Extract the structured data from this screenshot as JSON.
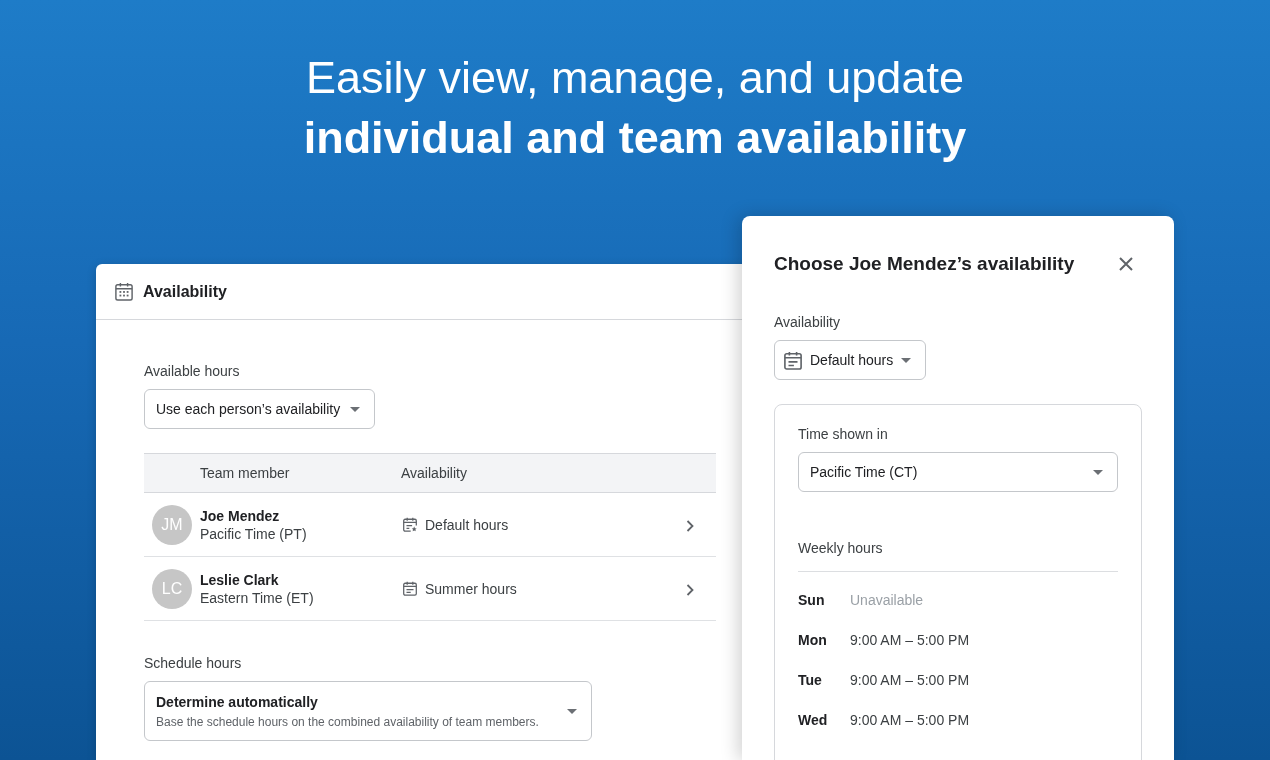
{
  "headline": "Easily view, manage, and update **individual and team availability**",
  "availability_panel": {
    "title": "Availability",
    "available_hours": {
      "label": "Available hours",
      "value": "Use each person’s availability"
    },
    "table": {
      "columns": [
        "Team member",
        "Availability"
      ],
      "rows": [
        {
          "initials": "JM",
          "name": "Joe Mendez",
          "time_zone": "Pacific Time (PT)",
          "availability": "Default hours",
          "kind": "default"
        },
        {
          "initials": "LC",
          "name": "Leslie Clark",
          "time_zone": "Eastern Time (ET)",
          "availability": "Summer hours",
          "kind": "custom"
        }
      ]
    },
    "schedule_hours": {
      "label": "Schedule hours",
      "value": "Determine automatically",
      "description": "Base the schedule hours on the combined availability of team members."
    }
  },
  "dialog": {
    "title": "Choose Joe Mendez’s availability",
    "availability": {
      "label": "Availability",
      "value": "Default hours"
    },
    "time_shown_in": {
      "label": "Time shown in",
      "value": "Pacific Time (CT)"
    },
    "weekly_hours": {
      "label": "Weekly hours",
      "days": [
        {
          "day": "Sun",
          "hours": "Unavailable",
          "available": false
        },
        {
          "day": "Mon",
          "hours": "9:00 AM – 5:00 PM",
          "available": true
        },
        {
          "day": "Tue",
          "hours": "9:00 AM – 5:00 PM",
          "available": true
        },
        {
          "day": "Wed",
          "hours": "9:00 AM – 5:00 PM",
          "available": true
        }
      ]
    }
  }
}
